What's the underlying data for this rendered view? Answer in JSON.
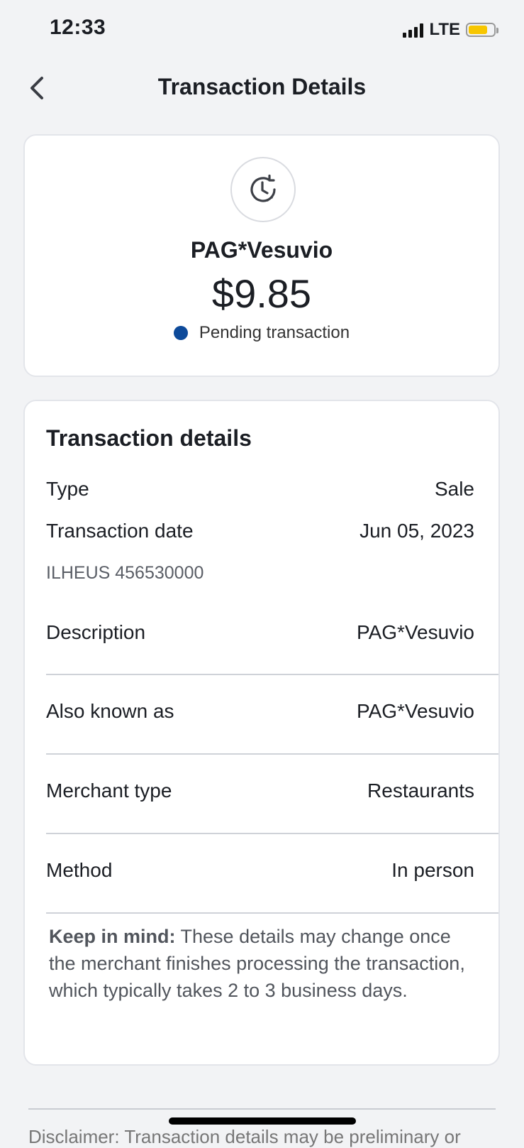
{
  "status_bar": {
    "time": "12:33",
    "network": "LTE",
    "battery_color": "#f7c600"
  },
  "nav": {
    "title": "Transaction Details",
    "back_icon": "chevron-left-icon"
  },
  "summary": {
    "icon": "pending-clock-icon",
    "merchant": "PAG*Vesuvio",
    "amount": "$9.85",
    "status": "Pending transaction",
    "status_color": "#0d4a9a"
  },
  "details": {
    "title": "Transaction details",
    "type": {
      "label": "Type",
      "value": "Sale"
    },
    "date": {
      "label": "Transaction date",
      "value": "Jun 05, 2023"
    },
    "location": "ILHEUS 456530000",
    "description": {
      "label": "Description",
      "value": "PAG*Vesuvio"
    },
    "aka": {
      "label": "Also known as",
      "value": "PAG*Vesuvio"
    },
    "merchant_type": {
      "label": "Merchant type",
      "value": "Restaurants"
    },
    "method": {
      "label": "Method",
      "value": "In person"
    },
    "note_bold": "Keep in mind:",
    "note_text": " These details may change once the merchant finishes processing the transaction, which typically takes 2 to 3 business days."
  },
  "footer": {
    "disclaimer": "Disclaimer: Transaction details may be preliminary or"
  }
}
